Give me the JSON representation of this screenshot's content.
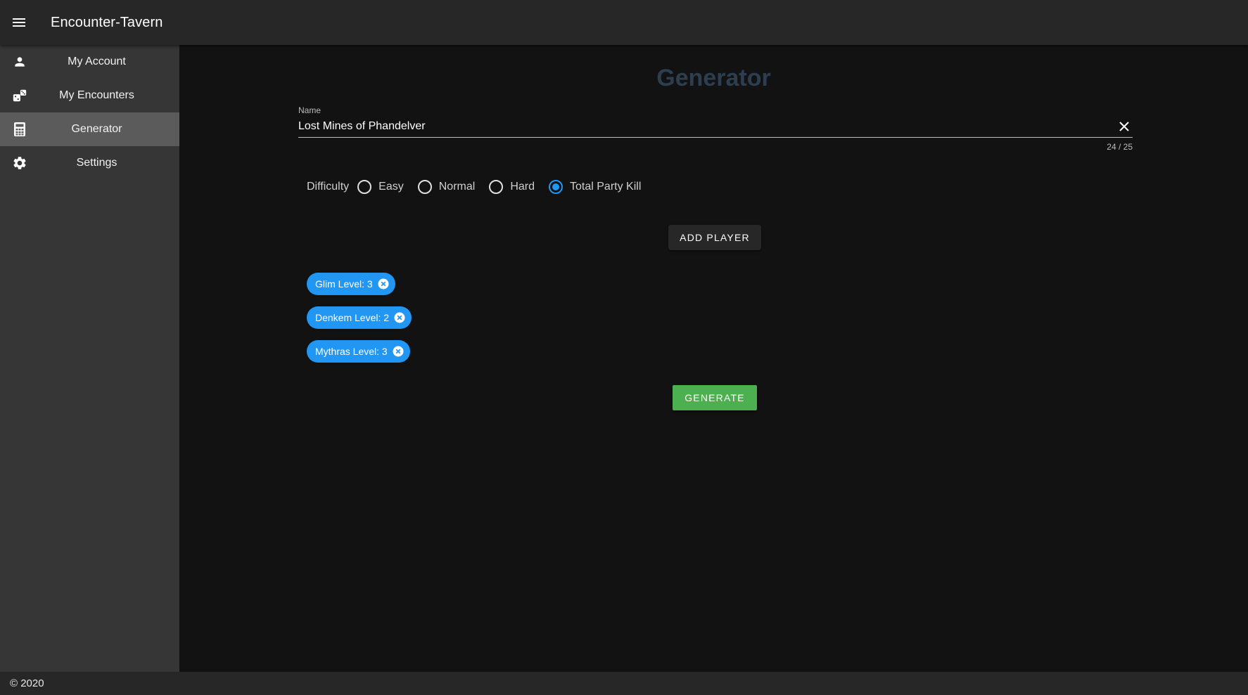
{
  "app": {
    "title": "Encounter-Tavern"
  },
  "sidebar": {
    "items": [
      {
        "label": "My Account",
        "icon": "account-icon",
        "active": false
      },
      {
        "label": "My Encounters",
        "icon": "dice-icon",
        "active": false
      },
      {
        "label": "Generator",
        "icon": "calculator-icon",
        "active": true
      },
      {
        "label": "Settings",
        "icon": "gear-icon",
        "active": false
      }
    ]
  },
  "main": {
    "title": "Generator",
    "name_field": {
      "label": "Name",
      "value": "Lost Mines of Phandelver",
      "counter": "24 / 25"
    },
    "difficulty": {
      "label": "Difficulty",
      "options": [
        "Easy",
        "Normal",
        "Hard",
        "Total Party Kill"
      ],
      "selected": "Total Party Kill"
    },
    "add_player_label": "ADD PLAYER",
    "players": [
      {
        "label": "Glim Level: 3"
      },
      {
        "label": "Denkem Level: 2"
      },
      {
        "label": "Mythras Level: 3"
      }
    ],
    "generate_label": "GENERATE"
  },
  "footer": {
    "text": "© 2020"
  },
  "colors": {
    "accent": "#2196f3",
    "generate": "#4caf50",
    "title": "#2c3e50",
    "appbar": "#272727",
    "sidebar": "#363636",
    "sidebar_active": "#5b5b5b",
    "background": "#121212"
  }
}
